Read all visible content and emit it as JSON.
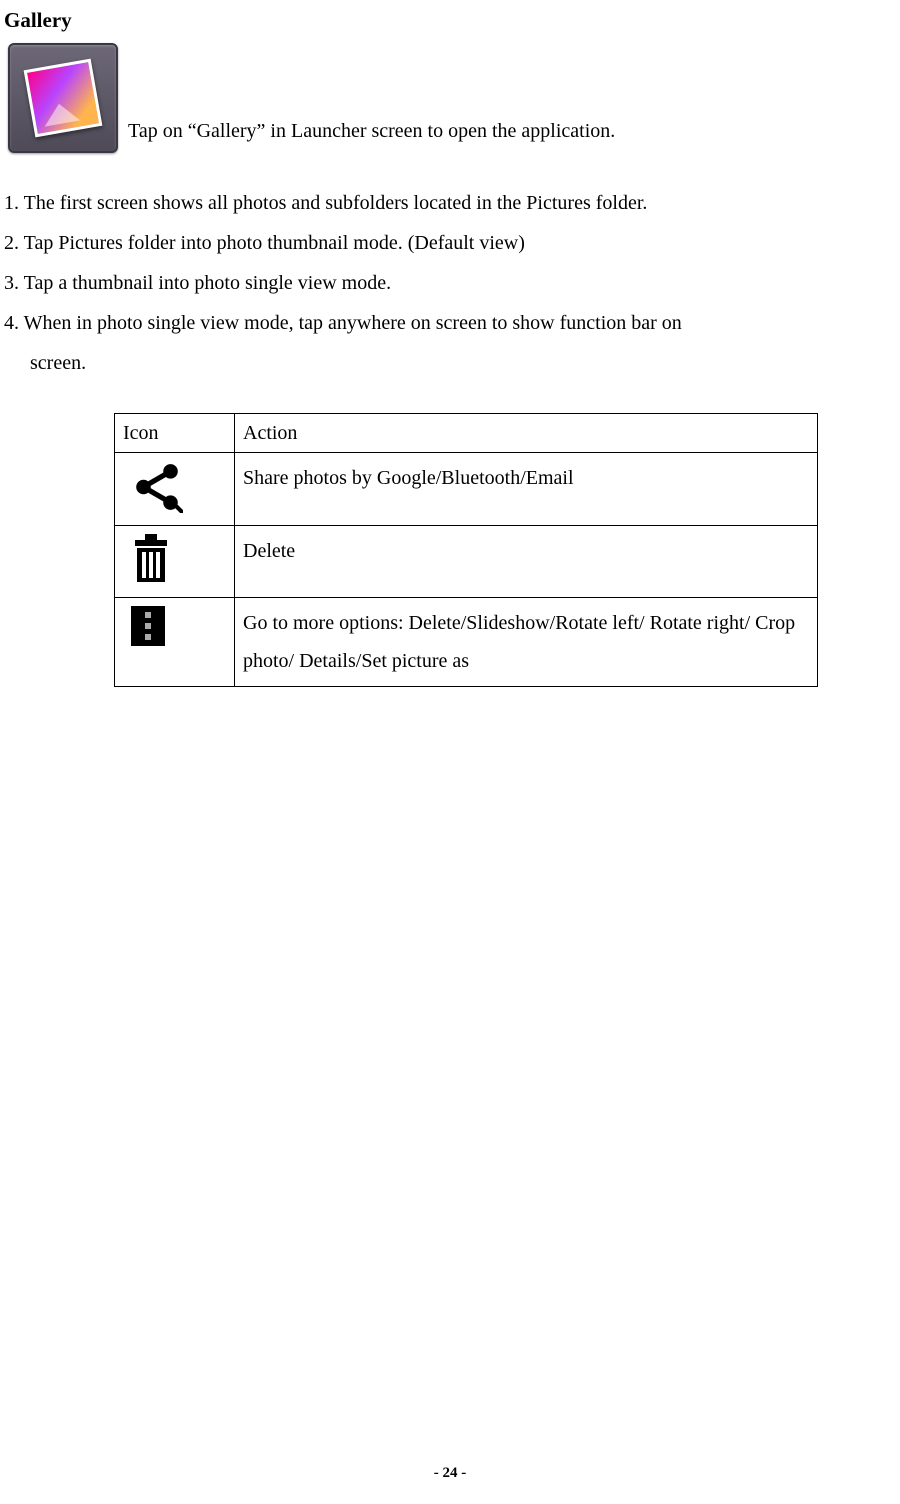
{
  "title": "Gallery",
  "intro": "Tap on “Gallery” in Launcher screen to open the application.",
  "steps": [
    "1. The first screen shows all photos and subfolders located in the Pictures folder.",
    "2. Tap Pictures folder into photo thumbnail mode. (Default view)",
    "3. Tap a thumbnail into photo single view mode.",
    "4. When in photo single view mode, tap anywhere on screen to show function bar on",
    "screen."
  ],
  "table": {
    "headers": {
      "icon": "Icon",
      "action": "Action"
    },
    "rows": [
      {
        "action": "Share photos by Google/Bluetooth/Email"
      },
      {
        "action": "Delete"
      },
      {
        "action": "Go to more options: Delete/Slideshow/Rotate left/ Rotate right/ Crop photo/ Details/Set picture as"
      }
    ]
  },
  "footer": "- 24 -"
}
